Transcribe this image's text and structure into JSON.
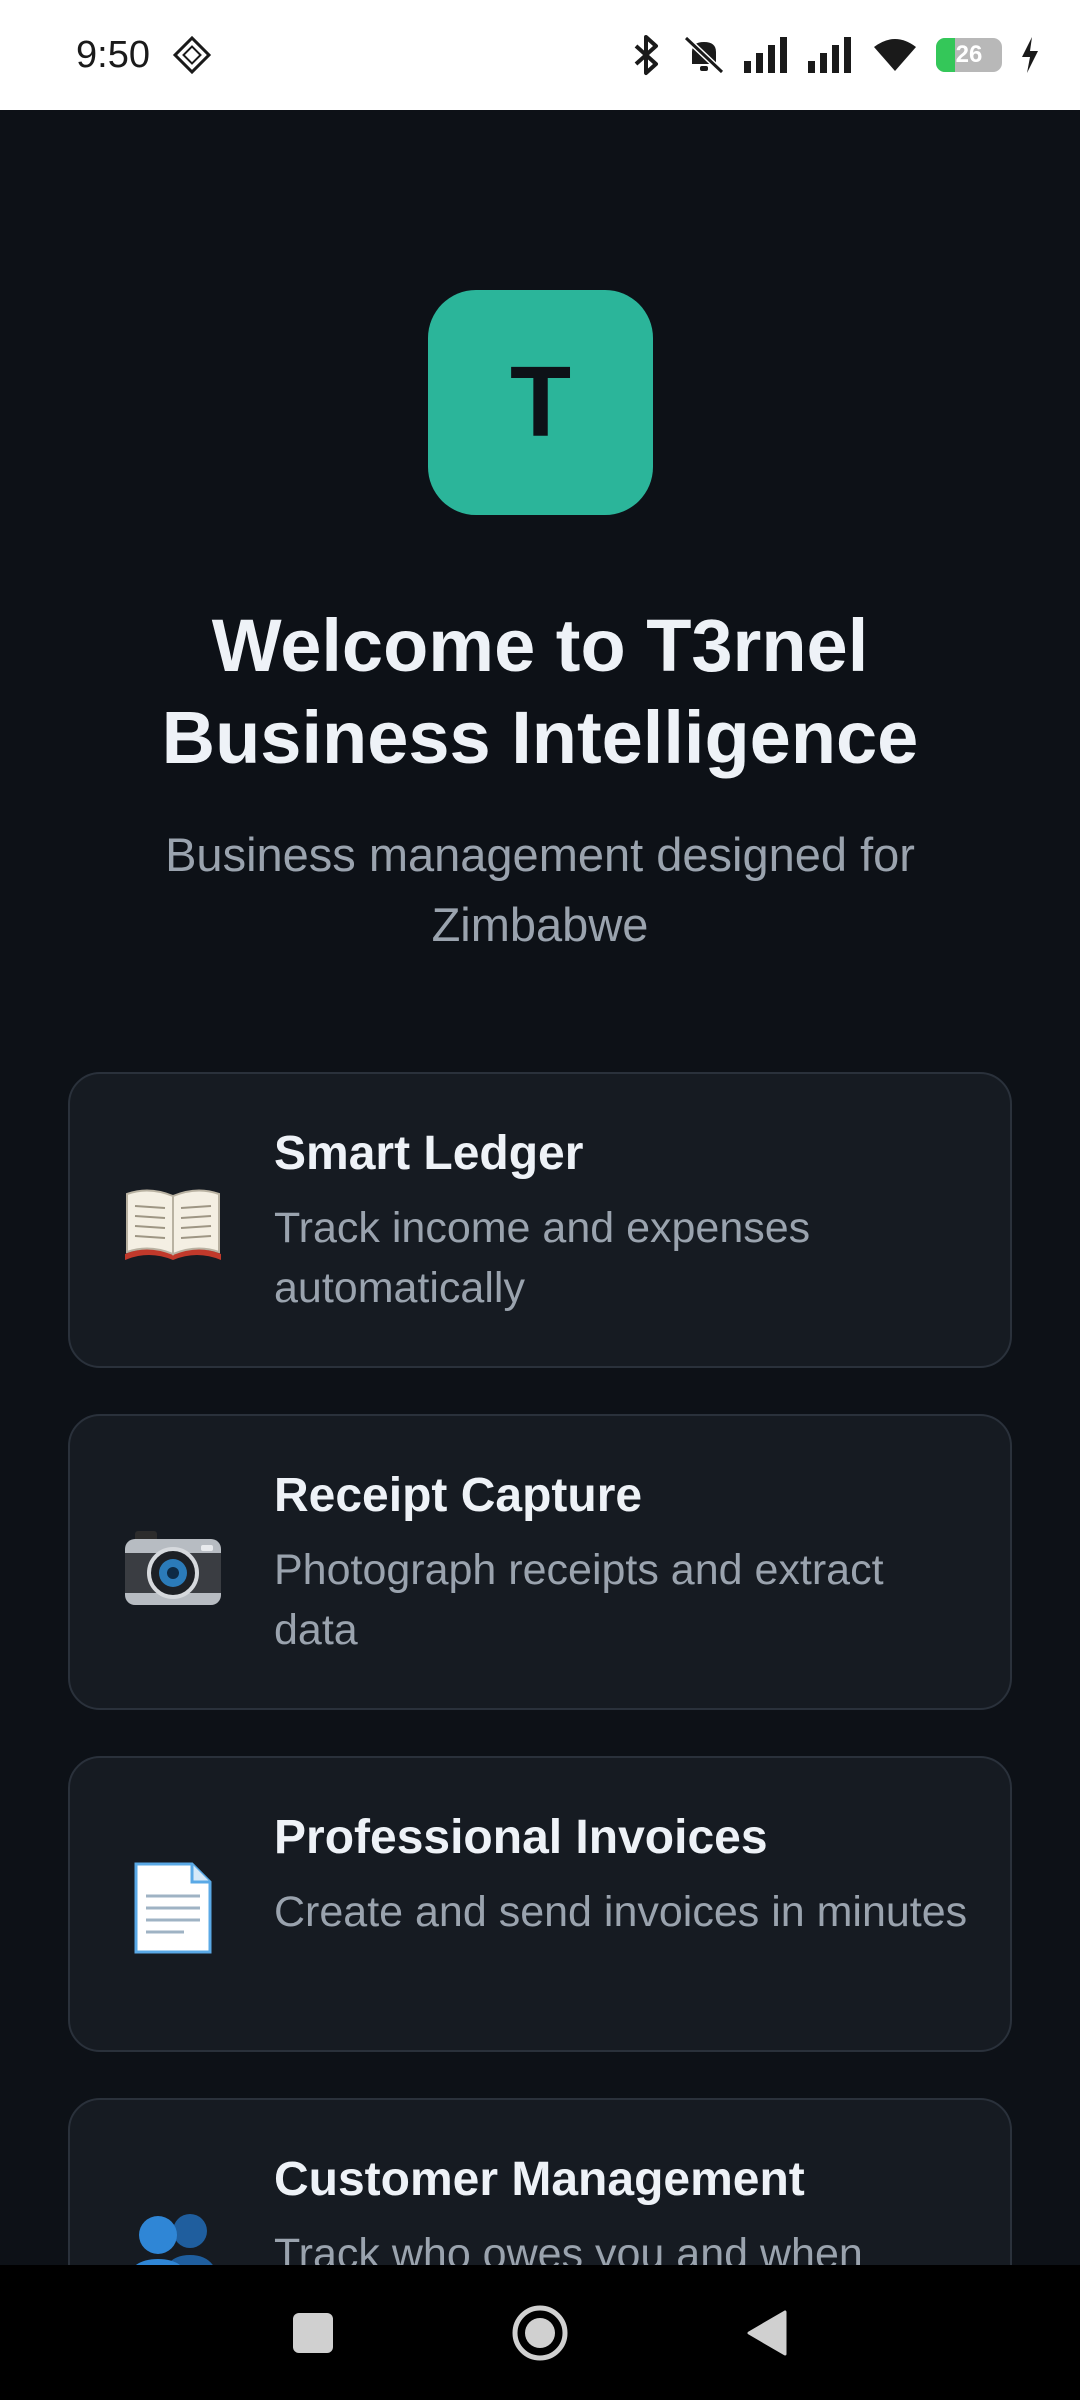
{
  "status_bar": {
    "time": "9:50",
    "battery_level": "26",
    "battery_fraction": 0.26,
    "icons": [
      "bluetooth-icon",
      "mute-icon",
      "signal-icon",
      "signal-icon",
      "wifi-icon",
      "battery-icon",
      "charging-icon"
    ]
  },
  "app": {
    "logo_letter": "T",
    "logo_color": "#2bb59a",
    "title": "Welcome to T3rnel Business Intelligence",
    "subtitle": "Business management designed for Zimbabwe"
  },
  "features": [
    {
      "icon": "book-icon",
      "title": "Smart Ledger",
      "description": "Track income and expenses automatically"
    },
    {
      "icon": "camera-icon",
      "title": "Receipt Capture",
      "description": "Photograph receipts and extract data"
    },
    {
      "icon": "document-icon",
      "title": "Professional Invoices",
      "description": "Create and send invoices in minutes"
    },
    {
      "icon": "people-icon",
      "title": "Customer Management",
      "description": "Track who owes you and when"
    }
  ],
  "nav_bar": {
    "buttons": [
      "recent-apps-button",
      "home-button",
      "back-button"
    ]
  }
}
